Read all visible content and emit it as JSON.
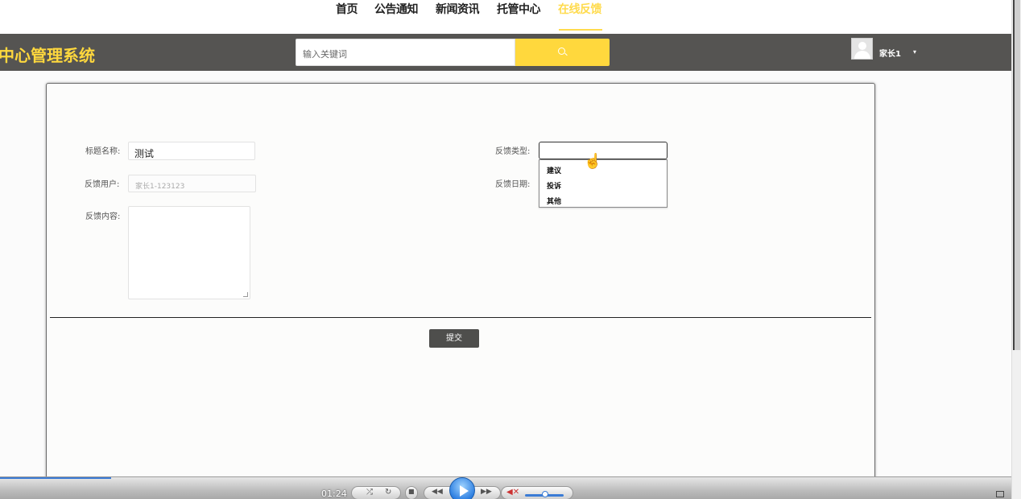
{
  "topnav": {
    "items": [
      {
        "label": "首页"
      },
      {
        "label": "公告通知"
      },
      {
        "label": "新闻资讯"
      },
      {
        "label": "托管中心"
      },
      {
        "label": "在线反馈",
        "active": true
      }
    ]
  },
  "header": {
    "title": "中心管理系统",
    "search_placeholder": "输入关键词",
    "user_name": "家长1"
  },
  "form": {
    "title_label": "标题名称:",
    "title_value": "测试",
    "user_label": "反馈用户:",
    "user_value": "家长1-123123",
    "content_label": "反馈内容:",
    "type_label": "反馈类型:",
    "date_label": "反馈日期:",
    "type_options": [
      "建议",
      "投诉",
      "其他"
    ],
    "submit_label": "提交"
  },
  "player": {
    "time": "01:24",
    "progress_fraction": 0.11
  },
  "colors": {
    "accent": "#ffd83d",
    "header_bg": "#555452",
    "button_bg": "#4e4e4c"
  }
}
